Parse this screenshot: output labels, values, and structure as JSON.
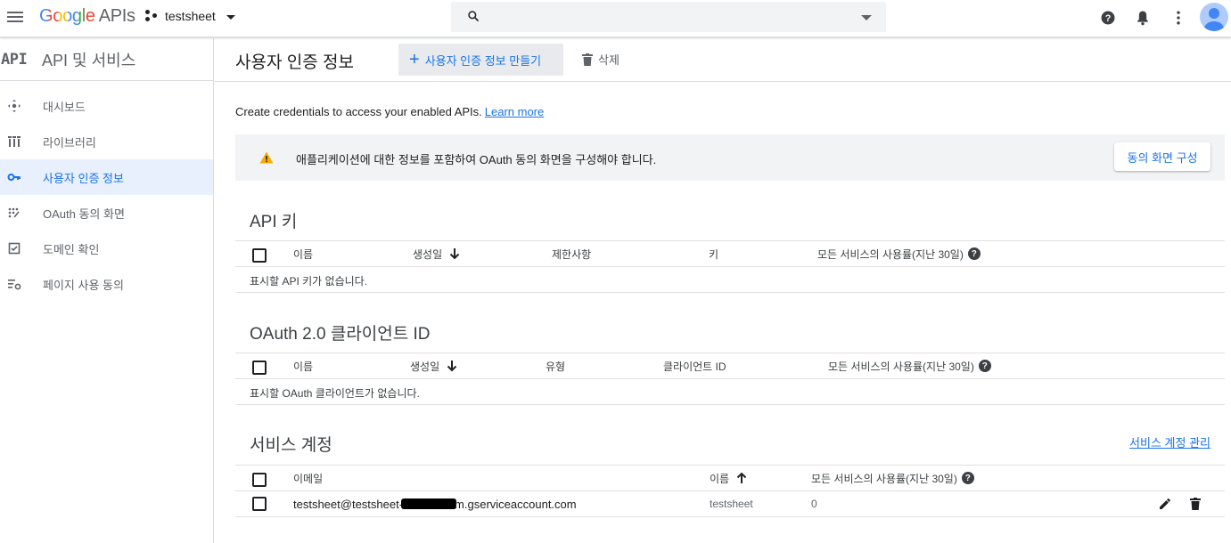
{
  "topbar": {
    "logo_google": "Google",
    "logo_apis": "APIs",
    "project_name": "testsheet",
    "search_placeholder": ""
  },
  "sidebar": {
    "badge": "API",
    "title": "API 및 서비스",
    "items": [
      {
        "label": "대시보드",
        "icon": "dashboard-icon",
        "active": false
      },
      {
        "label": "라이브러리",
        "icon": "library-icon",
        "active": false
      },
      {
        "label": "사용자 인증 정보",
        "icon": "key-icon",
        "active": true
      },
      {
        "label": "OAuth 동의 화면",
        "icon": "consent-icon",
        "active": false
      },
      {
        "label": "도메인 확인",
        "icon": "checkbox-icon",
        "active": false
      },
      {
        "label": "페이지 사용 동의",
        "icon": "settings-list-icon",
        "active": false
      }
    ]
  },
  "header": {
    "title": "사용자 인증 정보",
    "create_label": "사용자 인증 정보 만들기",
    "delete_label": "삭제"
  },
  "intro": {
    "text": "Create credentials to access your enabled APIs.",
    "link": "Learn more"
  },
  "warning": {
    "text": "애플리케이션에 대한 정보를 포함하여 OAuth 동의 화면을 구성해야 합니다.",
    "button": "동의 화면 구성"
  },
  "api_keys": {
    "title": "API 키",
    "columns": [
      "이름",
      "생성일",
      "제한사항",
      "키",
      "모든 서비스의 사용률(지난 30일)"
    ],
    "empty": "표시할 API 키가 없습니다."
  },
  "oauth": {
    "title": "OAuth 2.0 클라이언트 ID",
    "columns": [
      "이름",
      "생성일",
      "유형",
      "클라이언트 ID",
      "모든 서비스의 사용률(지난 30일)"
    ],
    "empty": "표시할 OAuth 클라이언트가 없습니다."
  },
  "service_accounts": {
    "title": "서비스 계정",
    "manage_link": "서비스 계정 관리",
    "columns": [
      "이메일",
      "이름",
      "모든 서비스의 사용률(지난 30일)"
    ],
    "rows": [
      {
        "email_prefix": "testsheet@testsheet-",
        "email_suffix": "m.gserviceaccount.com",
        "name": "testsheet",
        "usage": "0"
      }
    ]
  },
  "colors": {
    "accent": "#1a73e8",
    "active_bg": "#e8f0fe",
    "warning": "#f9ab00"
  }
}
